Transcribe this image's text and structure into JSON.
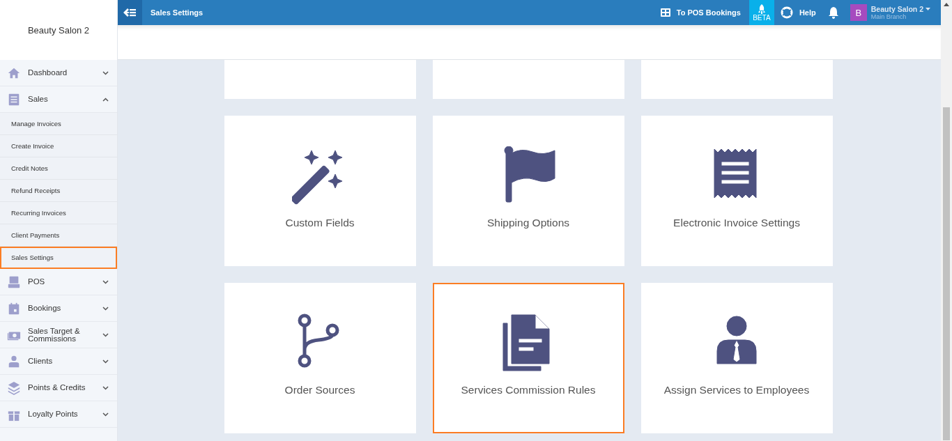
{
  "sidebar": {
    "brand": "Beauty Salon 2",
    "items": [
      {
        "label": "Dashboard",
        "expanded": false
      },
      {
        "label": "Sales",
        "expanded": true,
        "children": [
          {
            "label": "Manage Invoices",
            "selected": false
          },
          {
            "label": "Create Invoice",
            "selected": false
          },
          {
            "label": "Credit Notes",
            "selected": false
          },
          {
            "label": "Refund Receipts",
            "selected": false
          },
          {
            "label": "Recurring Invoices",
            "selected": false
          },
          {
            "label": "Client Payments",
            "selected": false
          },
          {
            "label": "Sales Settings",
            "selected": true
          }
        ]
      },
      {
        "label": "POS",
        "expanded": false
      },
      {
        "label": "Bookings",
        "expanded": false
      },
      {
        "label": "Sales Target & Commissions",
        "expanded": false
      },
      {
        "label": "Clients",
        "expanded": false
      },
      {
        "label": "Points & Credits",
        "expanded": false
      },
      {
        "label": "Loyalty Points",
        "expanded": false
      }
    ]
  },
  "topbar": {
    "title": "Sales Settings",
    "pos_link": "To POS Bookings",
    "beta": "BETA",
    "help": "Help",
    "account": {
      "initial": "B",
      "name": "Beauty Salon 2",
      "branch": "Main Branch"
    }
  },
  "tiles": [
    {
      "kind": "cut-off"
    },
    {
      "kind": "cut-off"
    },
    {
      "kind": "cut-off"
    },
    {
      "kind": "tile",
      "label": "Custom Fields",
      "highlighted": false
    },
    {
      "kind": "tile",
      "label": "Shipping Options",
      "highlighted": false
    },
    {
      "kind": "tile",
      "label": "Electronic Invoice Settings",
      "highlighted": false
    },
    {
      "kind": "tile",
      "label": "Order Sources",
      "highlighted": false
    },
    {
      "kind": "tile",
      "label": "Services Commission Rules",
      "highlighted": true
    },
    {
      "kind": "tile",
      "label": "Assign Services to Employees",
      "highlighted": false
    }
  ]
}
